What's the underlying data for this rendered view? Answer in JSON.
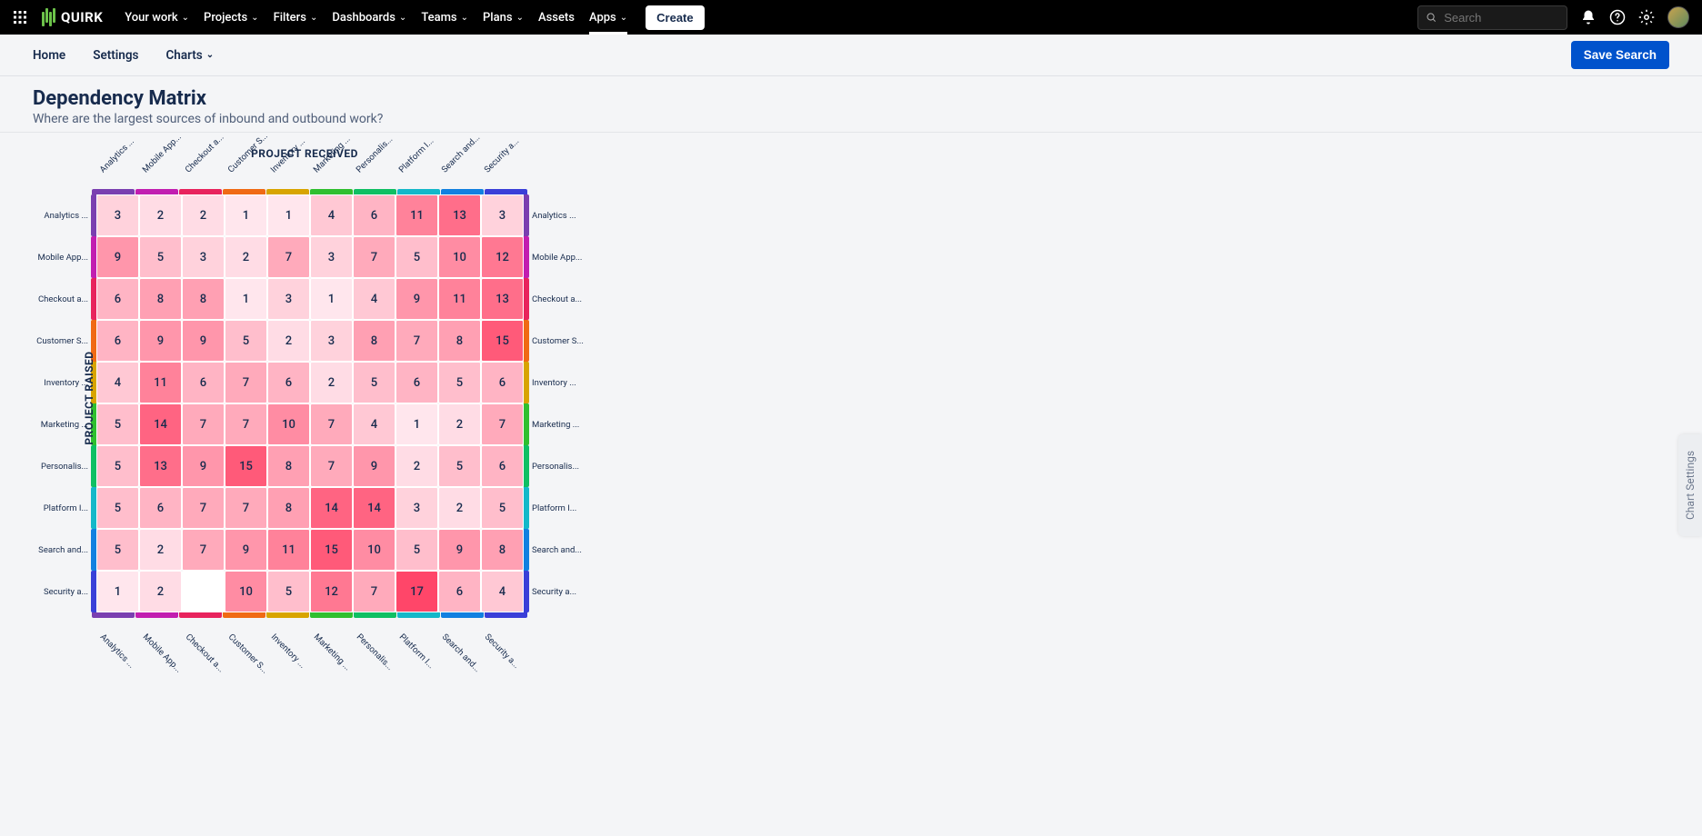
{
  "brand": "QUIRK",
  "nav": {
    "items": [
      "Your work",
      "Projects",
      "Filters",
      "Dashboards",
      "Teams",
      "Plans",
      "Assets",
      "Apps"
    ],
    "has_dropdown": [
      true,
      true,
      true,
      true,
      true,
      true,
      false,
      true
    ],
    "active_index": 7,
    "create": "Create"
  },
  "search": {
    "placeholder": "Search"
  },
  "secnav": {
    "home": "Home",
    "settings": "Settings",
    "charts": "Charts",
    "save": "Save Search"
  },
  "page": {
    "title": "Dependency Matrix",
    "subtitle": "Where are the largest sources of inbound and outbound work?"
  },
  "side_tab": "Chart Settings",
  "chart_data": {
    "type": "heatmap",
    "title": "Dependency Matrix",
    "xlabel": "PROJECT RECEIVED",
    "ylabel": "PROJECT RAISED",
    "categories": [
      "Analytics ...",
      "Mobile App...",
      "Checkout a...",
      "Customer S...",
      "Inventory ...",
      "Marketing ...",
      "Personalis...",
      "Platform I...",
      "Search and...",
      "Security a..."
    ],
    "colors": [
      "#7a3fb0",
      "#c21eb0",
      "#e8235d",
      "#f06a14",
      "#d8a400",
      "#2fbf2f",
      "#0fbf63",
      "#14b8c9",
      "#1280e0",
      "#3a3fd8"
    ],
    "values": [
      [
        3,
        2,
        2,
        1,
        1,
        4,
        6,
        11,
        13,
        3
      ],
      [
        9,
        5,
        3,
        2,
        7,
        3,
        7,
        5,
        10,
        12
      ],
      [
        6,
        8,
        8,
        1,
        3,
        1,
        4,
        9,
        11,
        13
      ],
      [
        6,
        9,
        9,
        5,
        2,
        3,
        8,
        7,
        8,
        15
      ],
      [
        4,
        11,
        6,
        7,
        6,
        2,
        5,
        6,
        5,
        6
      ],
      [
        5,
        14,
        7,
        7,
        10,
        7,
        4,
        1,
        2,
        7
      ],
      [
        5,
        13,
        9,
        15,
        8,
        7,
        9,
        2,
        5,
        6
      ],
      [
        5,
        6,
        7,
        7,
        8,
        14,
        14,
        3,
        2,
        5
      ],
      [
        5,
        2,
        7,
        9,
        11,
        15,
        10,
        5,
        9,
        8
      ],
      [
        1,
        2,
        null,
        10,
        5,
        12,
        7,
        17,
        6,
        4
      ]
    ]
  }
}
